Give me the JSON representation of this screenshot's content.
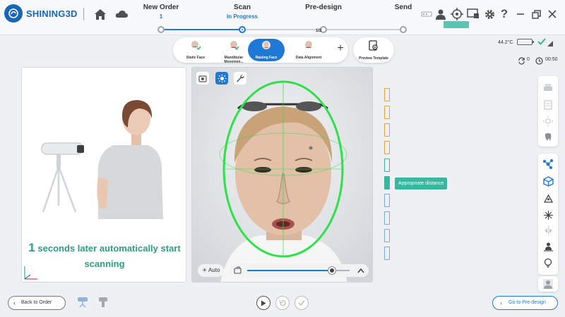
{
  "app": {
    "brand": "SHINING3D"
  },
  "steps": [
    {
      "label": "New Order",
      "sub": "1"
    },
    {
      "label": "Scan",
      "sub": "In Progress"
    },
    {
      "label": "Pre-design",
      "sub": ""
    },
    {
      "label": "Send",
      "sub": ""
    }
  ],
  "tools": [
    {
      "label": "Static Face"
    },
    {
      "label": "Mandibular Movemen..."
    },
    {
      "label": "Raising Face"
    },
    {
      "label": "Data Alignment",
      "badge": "1/2"
    }
  ],
  "preview_template": "Preview Template",
  "status": {
    "temperature": "44.2°C",
    "counter": "0",
    "timer": "00:50"
  },
  "left_panel": {
    "countdown": "1",
    "message_line1": "seconds later automatically start",
    "message_line2": "scanning"
  },
  "camera": {
    "auto_label": "Auto",
    "exposure_level": 0.83
  },
  "distance": {
    "tooltip": "Appropriate distance",
    "active_index": 5
  },
  "footer": {
    "back_label": "Back to Order",
    "next_label": "Go to Pre-design"
  },
  "colors": {
    "accent": "#1e78d6",
    "teal": "#3db4a0",
    "orange": "#e5a53c",
    "face_ring": "#2ee04a"
  }
}
